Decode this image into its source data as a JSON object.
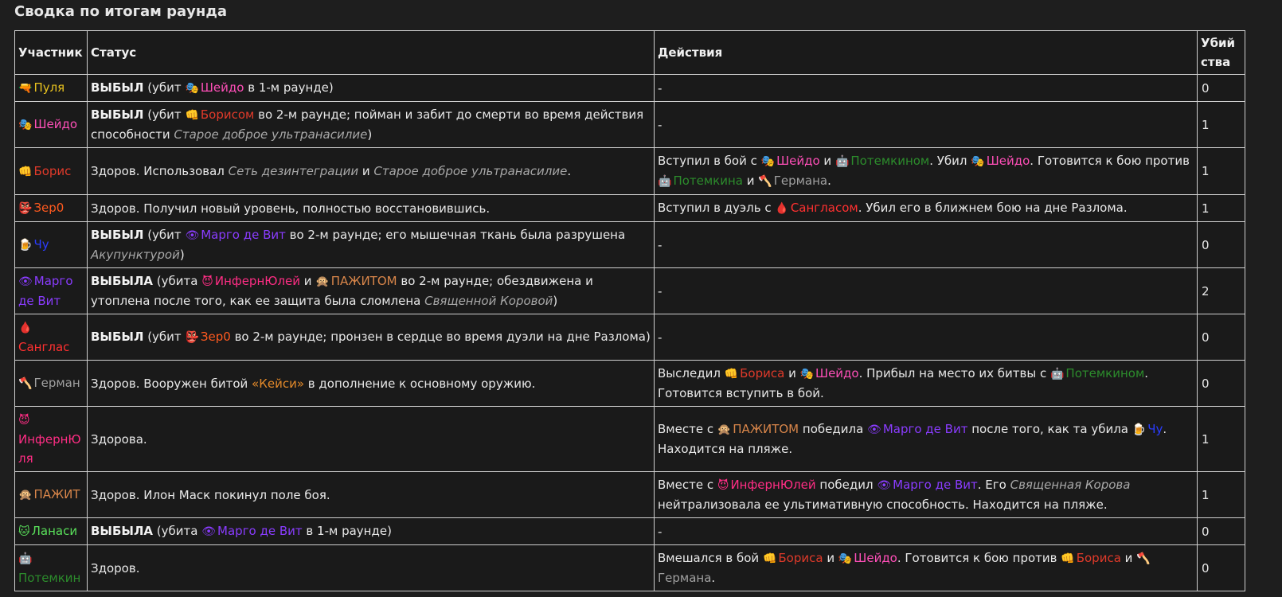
{
  "title": "Сводка по итогам раунда",
  "headers": {
    "participant": "Участник",
    "status": "Статус",
    "actions": "Действия",
    "kills": "Убийства"
  },
  "colors": {
    "Пуля": "#e8c21f",
    "Шейдо": "#ff4fb8",
    "Борис": "#e03a2a",
    "Зер0": "#ff5a1f",
    "Чу": "#2a3cff",
    "Марго де Вит": "#8a3cff",
    "Санглас": "#ff3030",
    "Герман": "#a0a0a0",
    "ИнфернЮля": "#ff2d84",
    "ПАЖИТ": "#d9864a",
    "Ланаси": "#59e05a",
    "Потемкин": "#2c8c2c"
  },
  "rows": [
    {
      "participant": {
        "icon": "🔫",
        "name": "Пуля",
        "cls": "c-pulya"
      },
      "status": [
        {
          "b": "ВЫБЫЛ"
        },
        {
          "t": " (убит "
        },
        {
          "p": "🎭",
          "n": "Шейдо",
          "c": "c-sheido"
        },
        {
          "t": " в 1-м раунде)"
        }
      ],
      "actions": [
        {
          "t": "-"
        }
      ],
      "kills": "0"
    },
    {
      "participant": {
        "icon": "🎭",
        "name": "Шейдо",
        "cls": "c-sheido"
      },
      "status": [
        {
          "b": "ВЫБЫЛ"
        },
        {
          "t": " (убит "
        },
        {
          "p": "👊",
          "n": "Борисом",
          "c": "c-boris"
        },
        {
          "t": " во 2-м раунде; пойман и забит до смерти во время действия способности "
        },
        {
          "i": "Старое доброе ультранасилие"
        },
        {
          "t": ")"
        }
      ],
      "actions": [
        {
          "t": "-"
        }
      ],
      "kills": "1"
    },
    {
      "participant": {
        "icon": "👊",
        "name": "Борис",
        "cls": "c-boris"
      },
      "status": [
        {
          "t": "Здоров. Использовал "
        },
        {
          "i": "Сеть дезинтеграции"
        },
        {
          "t": " и "
        },
        {
          "i": "Старое доброе ультранасилие"
        },
        {
          "t": "."
        }
      ],
      "actions": [
        {
          "t": "Вступил в бой с "
        },
        {
          "p": "🎭",
          "n": "Шейдо",
          "c": "c-sheido"
        },
        {
          "t": " и "
        },
        {
          "p": "🤖",
          "n": "Потемкином",
          "c": "c-potemkin"
        },
        {
          "t": ". Убил "
        },
        {
          "p": "🎭",
          "n": "Шейдо",
          "c": "c-sheido"
        },
        {
          "t": ". Готовится к бою против "
        },
        {
          "p": "🤖",
          "n": "Потемкина",
          "c": "c-potemkin"
        },
        {
          "t": " и "
        },
        {
          "p": "🪓",
          "n": "Германа",
          "c": "c-german"
        },
        {
          "t": "."
        }
      ],
      "kills": "1"
    },
    {
      "participant": {
        "icon": "👺",
        "name": "Зер0",
        "cls": "c-zer0"
      },
      "status": [
        {
          "t": "Здоров. Получил новый уровень, полностью восстановившись."
        }
      ],
      "actions": [
        {
          "t": "Вступил в дуэль с "
        },
        {
          "p": "🩸",
          "n": "Сангласом",
          "c": "c-sanglas"
        },
        {
          "t": ". Убил его в ближнем бою на дне Разлома."
        }
      ],
      "kills": "1"
    },
    {
      "participant": {
        "icon": "🍺",
        "name": "Чу",
        "cls": "c-chu"
      },
      "status": [
        {
          "b": "ВЫБЫЛ"
        },
        {
          "t": " (убит "
        },
        {
          "p": "👁",
          "n": "Марго де Вит",
          "c": "c-margo"
        },
        {
          "t": " во 2-м раунде; его мышечная ткань была разрушена "
        },
        {
          "i": "Акупунктурой"
        },
        {
          "t": ")"
        }
      ],
      "actions": [
        {
          "t": "-"
        }
      ],
      "kills": "0"
    },
    {
      "participant": {
        "icon": "👁",
        "name": "Марго де Вит",
        "cls": "c-margo"
      },
      "status": [
        {
          "b": "ВЫБЫЛА"
        },
        {
          "t": " (убита "
        },
        {
          "p": "😈",
          "n": "ИнфернЮлей",
          "c": "c-infern"
        },
        {
          "t": " и "
        },
        {
          "p": "🙊",
          "n": "ПАЖИТОМ",
          "c": "c-pazhit"
        },
        {
          "t": " во 2-м раунде; обездвижена и утоплена после того, как ее защита была сломлена "
        },
        {
          "i": "Священной Коровой"
        },
        {
          "t": ")"
        }
      ],
      "actions": [
        {
          "t": "-"
        }
      ],
      "kills": "2"
    },
    {
      "participant": {
        "icon": "🩸",
        "name": "Санглас",
        "cls": "c-sanglas"
      },
      "status": [
        {
          "b": "ВЫБЫЛ"
        },
        {
          "t": " (убит "
        },
        {
          "p": "👺",
          "n": "Зер0",
          "c": "c-zer0"
        },
        {
          "t": " во 2-м раунде; пронзен в сердце во время дуэли на дне Разлома)"
        }
      ],
      "actions": [
        {
          "t": "-"
        }
      ],
      "kills": "0"
    },
    {
      "participant": {
        "icon": "🪓",
        "name": "Герман",
        "cls": "c-german"
      },
      "status": [
        {
          "t": "Здоров. Вооружен битой "
        },
        {
          "o": "«Кейси»"
        },
        {
          "t": " в дополнение к основному оружию."
        }
      ],
      "actions": [
        {
          "t": "Выследил "
        },
        {
          "p": "👊",
          "n": "Бориса",
          "c": "c-boris"
        },
        {
          "t": " и "
        },
        {
          "p": "🎭",
          "n": "Шейдо",
          "c": "c-sheido"
        },
        {
          "t": ". Прибыл на место их битвы с "
        },
        {
          "p": "🤖",
          "n": "Потемкином",
          "c": "c-potemkin"
        },
        {
          "t": ". Готовится вступить в бой."
        }
      ],
      "kills": "0"
    },
    {
      "participant": {
        "icon": "😈",
        "name": "ИнфернЮля",
        "cls": "c-infern"
      },
      "status": [
        {
          "t": "Здорова."
        }
      ],
      "actions": [
        {
          "t": "Вместе с "
        },
        {
          "p": "🙊",
          "n": "ПАЖИТОМ",
          "c": "c-pazhit"
        },
        {
          "t": " победила "
        },
        {
          "p": "👁",
          "n": "Марго де Вит",
          "c": "c-margo"
        },
        {
          "t": " после того, как та убила "
        },
        {
          "p": "🍺",
          "n": "Чу",
          "c": "c-chu"
        },
        {
          "t": ". Находится на пляже."
        }
      ],
      "kills": "1"
    },
    {
      "participant": {
        "icon": "🙊",
        "name": "ПАЖИТ",
        "cls": "c-pazhit"
      },
      "status": [
        {
          "t": "Здоров. Илон Маск покинул поле боя."
        }
      ],
      "actions": [
        {
          "t": "Вместе с "
        },
        {
          "p": "😈",
          "n": "ИнфернЮлей",
          "c": "c-infern"
        },
        {
          "t": " победил "
        },
        {
          "p": "👁",
          "n": "Марго де Вит",
          "c": "c-margo"
        },
        {
          "t": ". Его "
        },
        {
          "i": "Священная Корова"
        },
        {
          "t": " нейтрализовала ее ультимативную способность. Находится на пляже."
        }
      ],
      "kills": "1"
    },
    {
      "participant": {
        "icon": "🐱",
        "name": "Ланаси",
        "cls": "c-lanasi"
      },
      "status": [
        {
          "b": "ВЫБЫЛА"
        },
        {
          "t": " (убита "
        },
        {
          "p": "👁",
          "n": "Марго де Вит",
          "c": "c-margo"
        },
        {
          "t": " в 1-м раунде)"
        }
      ],
      "actions": [
        {
          "t": "-"
        }
      ],
      "kills": "0"
    },
    {
      "participant": {
        "icon": "🤖",
        "name": "Потемкин",
        "cls": "c-potemkin"
      },
      "status": [
        {
          "t": "Здоров."
        }
      ],
      "actions": [
        {
          "t": "Вмешался в бой "
        },
        {
          "p": "👊",
          "n": "Бориса",
          "c": "c-boris"
        },
        {
          "t": " и "
        },
        {
          "p": "🎭",
          "n": "Шейдо",
          "c": "c-sheido"
        },
        {
          "t": ". Готовится к бою против "
        },
        {
          "p": "👊",
          "n": "Бориса",
          "c": "c-boris"
        },
        {
          "t": " и "
        },
        {
          "p": "🪓",
          "n": "Германа",
          "c": "c-german"
        },
        {
          "t": "."
        }
      ],
      "kills": "0"
    }
  ]
}
